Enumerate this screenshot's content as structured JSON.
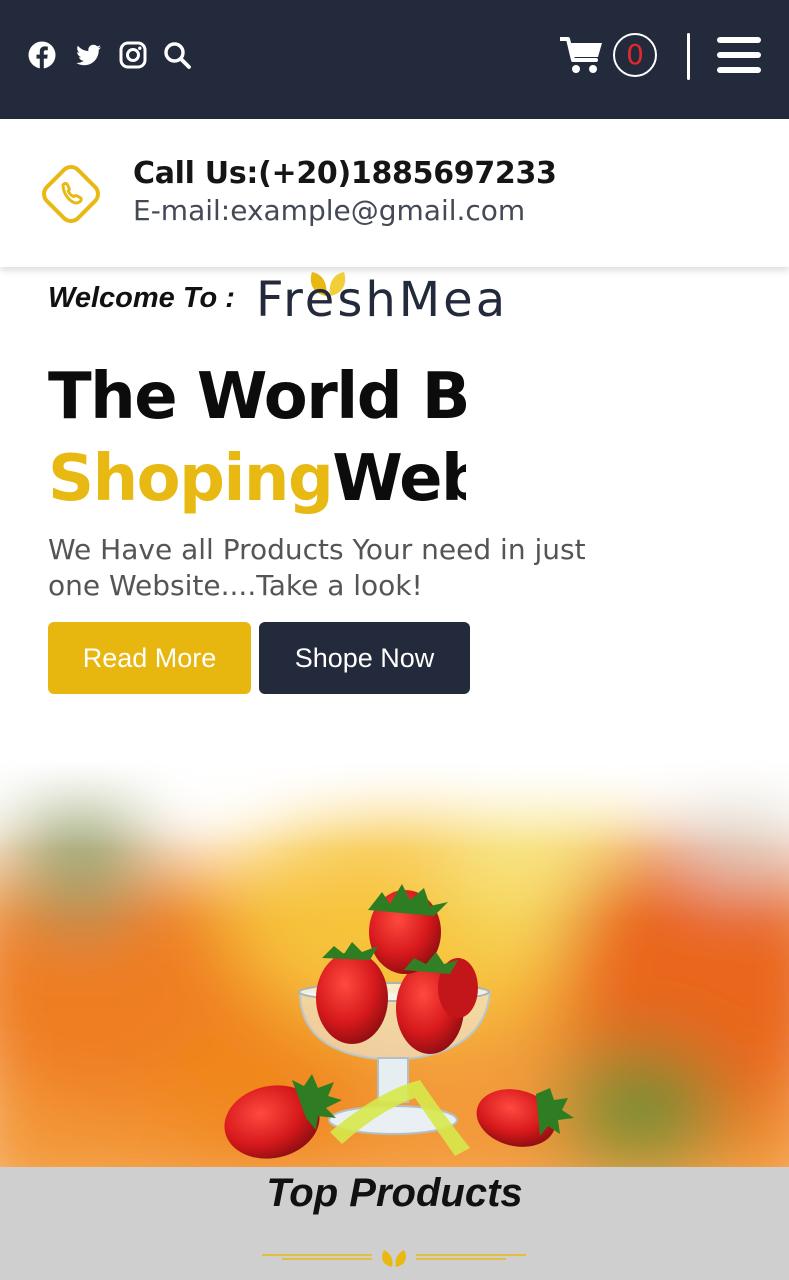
{
  "header": {
    "social": [
      "facebook-icon",
      "twitter-icon",
      "instagram-icon",
      "search-icon"
    ],
    "cart_count": "0",
    "icons": {
      "cart": "shopping-cart-icon",
      "menu": "hamburger-menu-icon"
    }
  },
  "contact": {
    "phone_icon": "phone-icon",
    "call": "Call Us:(+20)1885697233",
    "email": "E-mail:example@gmail.com"
  },
  "hero": {
    "welcome": "Welcome To :",
    "brand": "FreshMea",
    "headline_line1": "The World Be",
    "headline_accent": "Shoping",
    "headline_line2_rest": "Webs",
    "subtitle": "We Have all Products Your need in just one Website....Take a look!",
    "read_more": "Read More",
    "shop_now": "Shope Now"
  },
  "sections": {
    "top_products": "Top Products"
  },
  "colors": {
    "navbar": "#232a3b",
    "accent": "#e8b912",
    "badge_text": "#e02a2a",
    "products_band": "#cfcfcf"
  }
}
